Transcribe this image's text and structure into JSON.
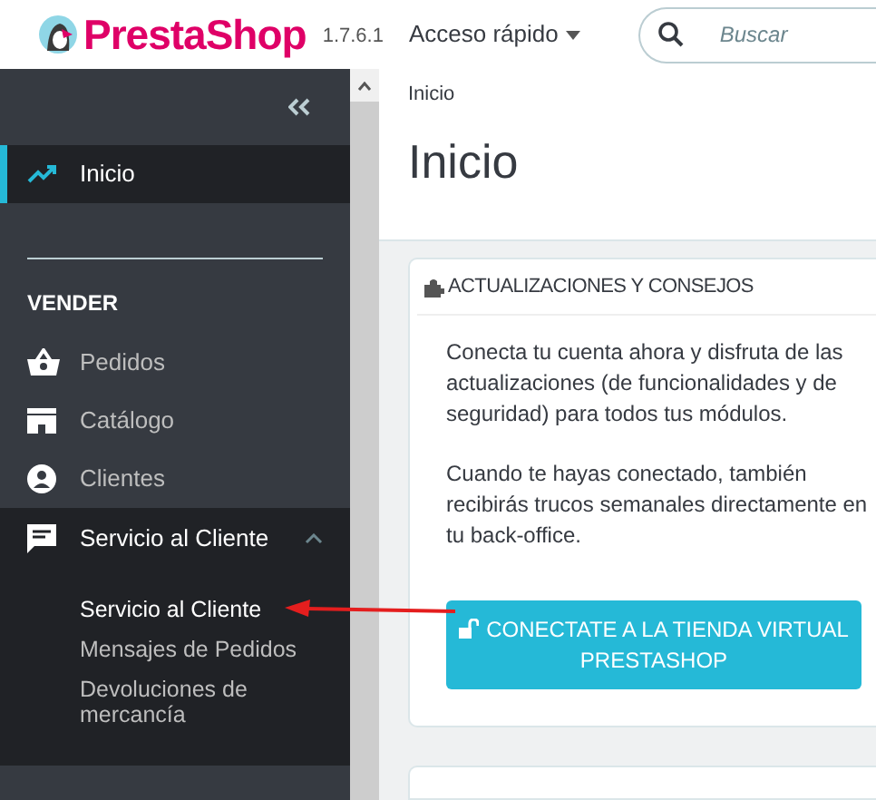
{
  "header": {
    "brand": "PrestaShop",
    "version": "1.7.6.1",
    "quick_access": "Acceso rápido",
    "search": {
      "placeholder": "Buscar"
    }
  },
  "sidebar": {
    "items": [
      {
        "kind": "link",
        "label": "Inicio",
        "selected": true
      },
      {
        "kind": "section",
        "label": "VENDER"
      },
      {
        "kind": "link",
        "label": "Pedidos",
        "selected": false
      },
      {
        "kind": "link",
        "label": "Catálogo",
        "selected": false
      },
      {
        "kind": "link",
        "label": "Clientes",
        "selected": false
      },
      {
        "kind": "group",
        "label": "Servicio al Cliente",
        "expanded": true,
        "children": [
          {
            "label": "Servicio al Cliente",
            "selected": true
          },
          {
            "label": "Mensajes de Pedidos",
            "selected": false
          },
          {
            "label": "Devoluciones de mercancía",
            "selected": false
          }
        ]
      }
    ]
  },
  "breadcrumb": "Inicio",
  "page_title": "Inicio",
  "card": {
    "title": "ACTUALIZACIONES Y CONSEJOS",
    "paragraphs": [
      "Conecta tu cuenta ahora y disfruta de las actualizaciones (de funcionalidades y de seguridad) para todos tus módulos.",
      "Cuando te hayas conectado, también recibirás trucos semanales directamente en tu back-office."
    ],
    "button": "CONECTATE A LA TIENDA VIRTUAL PRESTASHOP"
  }
}
